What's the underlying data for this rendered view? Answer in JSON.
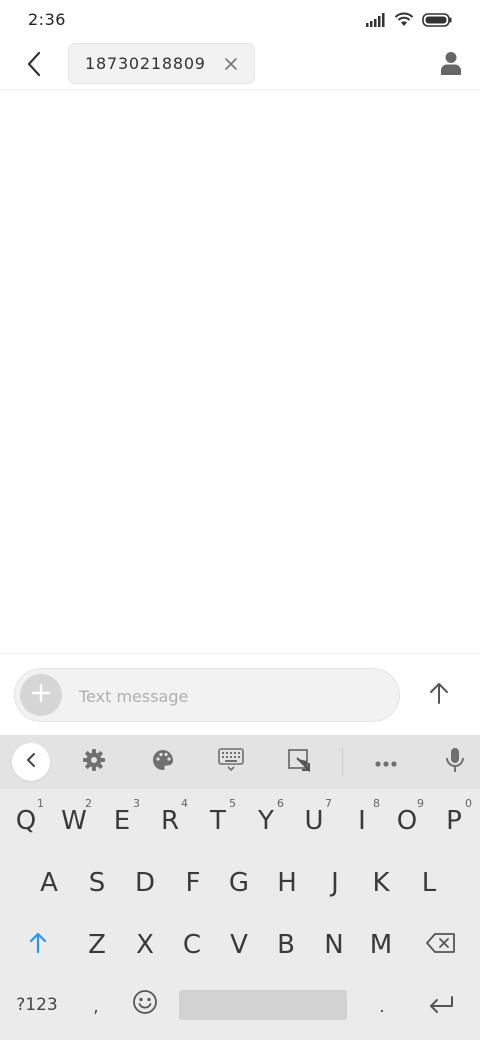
{
  "status_bar": {
    "time": "2:36",
    "icons": [
      "signal-icon",
      "wifi-icon",
      "battery-icon"
    ]
  },
  "header": {
    "back_icon": "chevron-left-icon",
    "recipient": "18730218809",
    "recipient_remove_icon": "close-icon",
    "contact_icon": "person-icon"
  },
  "compose": {
    "attach_icon": "plus-icon",
    "placeholder": "Text message",
    "value": "",
    "send_icon": "arrow-up-icon"
  },
  "keyboard": {
    "toolbar": [
      "chevron-left-icon",
      "gear-icon",
      "palette-icon",
      "keyboard-icon",
      "resize-icon",
      "more-icon",
      "microphone-icon"
    ],
    "row1": [
      {
        "key": "Q",
        "hint": "1"
      },
      {
        "key": "W",
        "hint": "2"
      },
      {
        "key": "E",
        "hint": "3"
      },
      {
        "key": "R",
        "hint": "4"
      },
      {
        "key": "T",
        "hint": "5"
      },
      {
        "key": "Y",
        "hint": "6"
      },
      {
        "key": "U",
        "hint": "7"
      },
      {
        "key": "I",
        "hint": "8"
      },
      {
        "key": "O",
        "hint": "9"
      },
      {
        "key": "P",
        "hint": "0"
      }
    ],
    "row2": [
      "A",
      "S",
      "D",
      "F",
      "G",
      "H",
      "J",
      "K",
      "L"
    ],
    "row3": [
      "Z",
      "X",
      "C",
      "V",
      "B",
      "N",
      "M"
    ],
    "shift_icon": "shift-arrow-icon",
    "backspace_icon": "backspace-icon",
    "symbols_label": "?123",
    "comma_label": ",",
    "emoji_icon": "emoji-icon",
    "period_label": ".",
    "enter_icon": "enter-icon"
  },
  "colors": {
    "accent": "#2196f3",
    "keyboard_bg": "#ebebeb",
    "toolbar_bg": "#e3e3e3",
    "chip_bg": "#f2f2f2"
  }
}
